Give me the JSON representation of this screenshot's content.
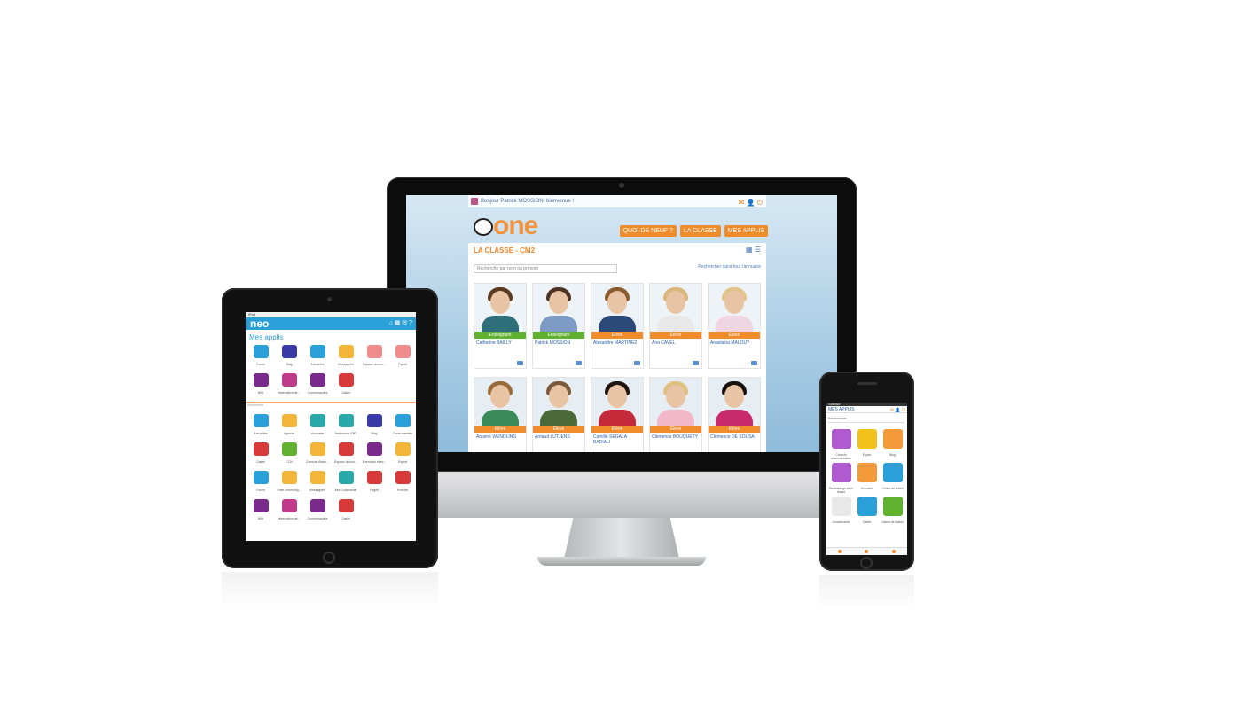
{
  "imac": {
    "greeting": "Bonjour Patrick MOSSION, bienvenue !",
    "logo": "one",
    "nav": [
      "QUOI DE NEUF ?",
      "LA CLASSE",
      "MES APPLIS"
    ],
    "panel_title": "LA CLASSE - CM2",
    "search_placeholder": "Recherche par nom ou prénom",
    "search_all_link": "Rechercher dans tout l'annuaire",
    "people": [
      {
        "name": "Catherine BAILLY",
        "role": "Enseignant",
        "role_color": "#5fb12f",
        "hair": "#5a3a22",
        "body": "#2f6f7a"
      },
      {
        "name": "Patrick MOSSION",
        "role": "Enseignant",
        "role_color": "#5fb12f",
        "hair": "#4a3322",
        "body": "#7d9bc4"
      },
      {
        "name": "Alexandre MARTINEZ",
        "role": "Élève",
        "role_color": "#f08c2c",
        "hair": "#8a5a30",
        "body": "#2b4a7a"
      },
      {
        "name": "Ana CAVEL",
        "role": "Élève",
        "role_color": "#f08c2c",
        "hair": "#d9b77a",
        "body": "#e8e8e8"
      },
      {
        "name": "Anastacia MALOUY",
        "role": "Élève",
        "role_color": "#f08c2c",
        "hair": "#e2c38a",
        "body": "#f0d6e0"
      },
      {
        "name": "Antoine WENDLING",
        "role": "Élève",
        "role_color": "#f08c2c",
        "hair": "#9a6a3a",
        "body": "#3a8a5a"
      },
      {
        "name": "Arnaud LUTJENS",
        "role": "Élève",
        "role_color": "#f08c2c",
        "hair": "#7a5a3a",
        "body": "#4a6a3a"
      },
      {
        "name": "Camille SEGALA BADIALI",
        "role": "Élève",
        "role_color": "#f08c2c",
        "hair": "#1e1410",
        "body": "#c42a3a"
      },
      {
        "name": "Clemence BOUQUETY",
        "role": "Élève",
        "role_color": "#f08c2c",
        "hair": "#e0c080",
        "body": "#f2b8c8"
      },
      {
        "name": "Clemence DE SOUSA",
        "role": "Élève",
        "role_color": "#f08c2c",
        "hair": "#1a120e",
        "body": "#c82a6a"
      }
    ]
  },
  "ipad": {
    "status": "iPad",
    "logo": "neo",
    "title": "Mes applis",
    "favorites": [
      {
        "label": "Forum",
        "color": "#2a9fd8"
      },
      {
        "label": "Blog",
        "color": "#3a3aa8"
      },
      {
        "label": "Actualités",
        "color": "#2a9fd8"
      },
      {
        "label": "Messagerie",
        "color": "#f3b63a"
      },
      {
        "label": "Espace docum...",
        "color": "#f08c8c"
      },
      {
        "label": "Pages",
        "color": "#f08c8c"
      },
      {
        "label": "Wiki",
        "color": "#7a2a8a"
      },
      {
        "label": "réservation de...",
        "color": "#c03a8a"
      },
      {
        "label": "Communautés",
        "color": "#7a2a8a"
      },
      {
        "label": "Casier",
        "color": "#d83a3a"
      }
    ],
    "separator_label": "Rechercher",
    "apps": [
      {
        "label": "Actualités",
        "color": "#2a9fd8"
      },
      {
        "label": "Agenda",
        "color": "#f3b63a"
      },
      {
        "label": "Annuaire",
        "color": "#2aa8a8"
      },
      {
        "label": "Assistance ENT",
        "color": "#2aa8a8"
      },
      {
        "label": "Blog",
        "color": "#3a3aa8"
      },
      {
        "label": "Carte mentale",
        "color": "#2a9fd8"
      },
      {
        "label": "Casier",
        "color": "#d83a3a"
      },
      {
        "label": "CCN",
        "color": "#5fb12f"
      },
      {
        "label": "Console d'adm...",
        "color": "#f3b63a"
      },
      {
        "label": "Espace docum...",
        "color": "#d83a3a"
      },
      {
        "label": "Exercices et év...",
        "color": "#7a2a8a"
      },
      {
        "label": "Export",
        "color": "#f3b63a"
      },
      {
        "label": "Forum",
        "color": "#2a9fd8"
      },
      {
        "label": "Frise chronolog...",
        "color": "#f3b63a"
      },
      {
        "label": "Messagerie",
        "color": "#f3b63a"
      },
      {
        "label": "Mur Collaboratif",
        "color": "#2aa8a8"
      },
      {
        "label": "Pages",
        "color": "#d83a3a"
      },
      {
        "label": "Pronote",
        "color": "#d83a3a"
      },
      {
        "label": "Wiki",
        "color": "#7a2a8a"
      },
      {
        "label": "réservation de...",
        "color": "#c03a8a"
      },
      {
        "label": "Communautés",
        "color": "#7a2a8a"
      },
      {
        "label": "Casier",
        "color": "#d83a3a"
      }
    ]
  },
  "iphone": {
    "status": "CARRIER",
    "title": "MES APPLIS",
    "search": "Rechercher",
    "apps": [
      {
        "label": "Console d'administration",
        "color": "#b05ad0"
      },
      {
        "label": "Export",
        "color": "#f3c21a"
      },
      {
        "label": "Blog",
        "color": "#f39a3a"
      },
      {
        "label": "Paramétrage de la classe",
        "color": "#b05ad0"
      },
      {
        "label": "Annuaire",
        "color": "#f39a3a"
      },
      {
        "label": "Cahier de textes",
        "color": "#2a9fd8"
      },
      {
        "label": "Gouvernance",
        "color": "#e8e8e8"
      },
      {
        "label": "Casier",
        "color": "#2a9fd8"
      },
      {
        "label": "Carnet de liaison",
        "color": "#5fb12f"
      }
    ]
  }
}
